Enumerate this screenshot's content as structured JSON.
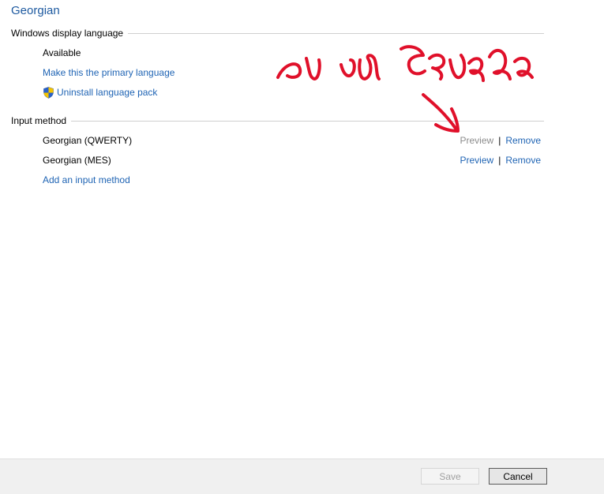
{
  "page": {
    "title": "Georgian"
  },
  "display_language": {
    "header": "Windows display language",
    "status": "Available",
    "make_primary_link": "Make this the primary language",
    "uninstall_link": "Uninstall language pack"
  },
  "input_method": {
    "header": "Input method",
    "methods": [
      {
        "name": "Georgian (QWERTY)",
        "preview": "Preview",
        "separator": "|",
        "remove": "Remove",
        "preview_enabled": false
      },
      {
        "name": "Georgian (MES)",
        "preview": "Preview",
        "separator": "|",
        "remove": "Remove",
        "preview_enabled": true
      }
    ],
    "add_link": "Add an input method"
  },
  "footer": {
    "save_label": "Save",
    "cancel_label": "Cancel"
  },
  "colors": {
    "link": "#1f64b4",
    "title": "#1e5aa0",
    "disabled": "#8c8c8c",
    "annotation": "#e0102a"
  },
  "icons": {
    "uninstall": "uac-shield-icon"
  }
}
